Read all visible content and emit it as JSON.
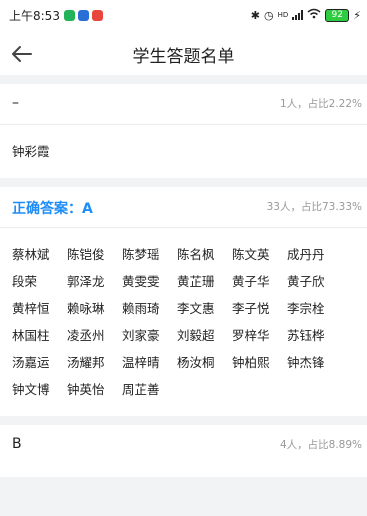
{
  "status_bar": {
    "time": "上午8:53",
    "battery": "92",
    "signal_hd": "HD"
  },
  "header": {
    "title": "学生答题名单",
    "back_icon": "arrow-left-icon"
  },
  "sections": [
    {
      "option": "–",
      "correct": false,
      "stat": "1人，占比2.22%",
      "students": [
        "钟彩霞"
      ]
    },
    {
      "option": "正确答案：A",
      "correct": true,
      "stat": "33人，占比73.33%",
      "students": [
        "蔡林斌",
        "陈铠俊",
        "陈梦瑶",
        "陈名枫",
        "陈文英",
        "成丹丹",
        "段荣",
        "郭泽龙",
        "黄雯雯",
        "黄芷珊",
        "黄子华",
        "黄子欣",
        "黄梓恒",
        "赖咏琳",
        "赖雨琦",
        "李文惠",
        "李子悦",
        "李宗栓",
        "林国柱",
        "凌丞州",
        "刘家豪",
        "刘毅超",
        "罗梓华",
        "苏钰桦",
        "汤嘉运",
        "汤耀邦",
        "温梓晴",
        "杨汝桐",
        "钟柏熙",
        "钟杰锋",
        "钟文博",
        "钟英怡",
        "周芷善"
      ]
    },
    {
      "option": "B",
      "correct": false,
      "stat": "4人，占比8.89%",
      "students": []
    }
  ],
  "colors": {
    "accent": "#1f8df6",
    "muted": "#999999",
    "background": "#f2f3f5"
  }
}
